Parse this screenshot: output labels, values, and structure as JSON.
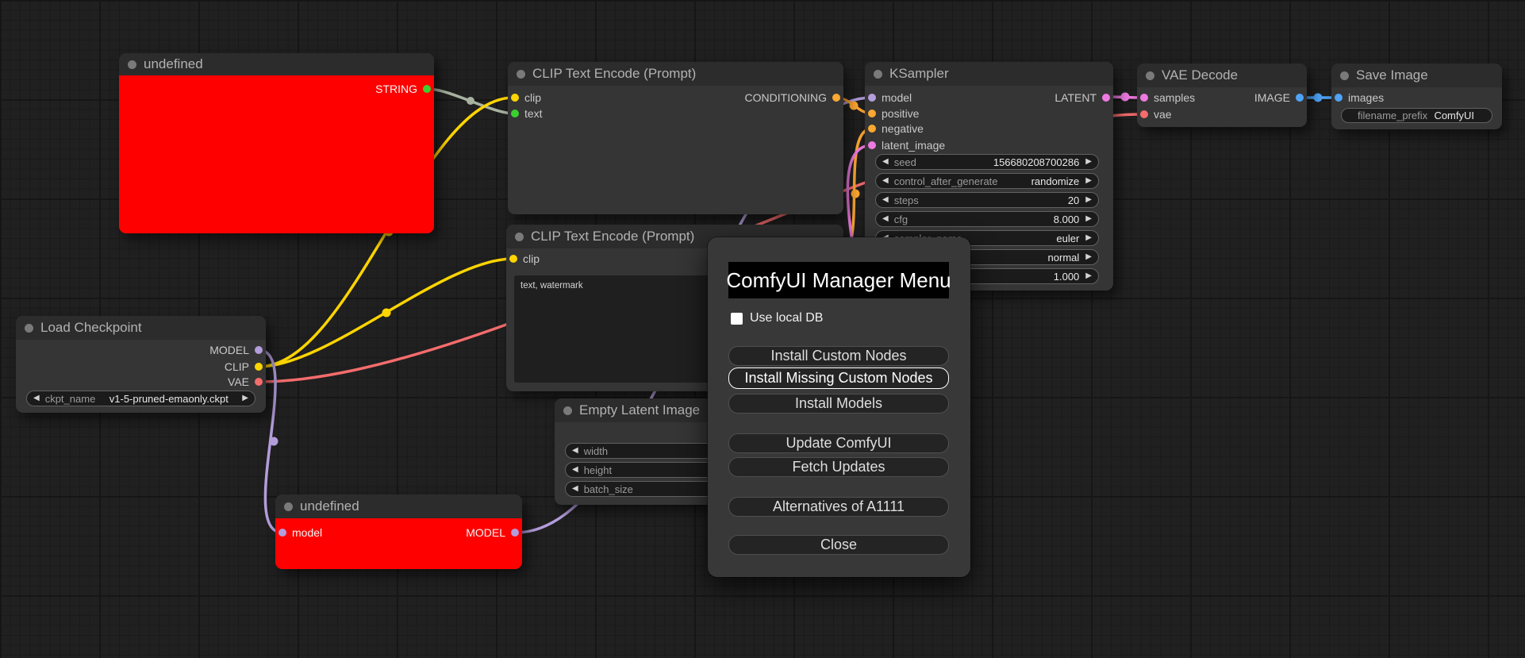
{
  "colors": {
    "MODEL": "#b39ddb",
    "CLIP": "#ffd500",
    "VAE": "#f56c6c",
    "CONDITIONING": "#ffa832",
    "LATENT": "#ee7ae0",
    "IMAGE": "#4fa4f7",
    "STRING_DOT": "#3ad130",
    "STRING_WIRE": "#a8b2a0",
    "ERROR_BODY": "#ff0000"
  },
  "nodes": {
    "undef_top": {
      "title": "undefined",
      "out_string": "STRING"
    },
    "clip1": {
      "title": "CLIP Text Encode (Prompt)",
      "in_clip": "clip",
      "in_text": "text",
      "out_cond": "CONDITIONING"
    },
    "clip2": {
      "title": "CLIP Text Encode (Prompt)",
      "in_clip": "clip",
      "prompt_text": "text, watermark"
    },
    "ksampler": {
      "title": "KSampler",
      "in_model": "model",
      "in_positive": "positive",
      "in_negative": "negative",
      "in_latent": "latent_image",
      "out_latent": "LATENT",
      "widgets": [
        {
          "label": "seed",
          "value": "156680208700286"
        },
        {
          "label": "control_after_generate",
          "value": "randomize"
        },
        {
          "label": "steps",
          "value": "20"
        },
        {
          "label": "cfg",
          "value": "8.000"
        },
        {
          "label": "sampler_name",
          "value": "euler"
        },
        {
          "label": "",
          "value": "normal"
        },
        {
          "label": "",
          "value": "1.000"
        }
      ]
    },
    "vae_decode": {
      "title": "VAE Decode",
      "in_samples": "samples",
      "in_vae": "vae",
      "out_image": "IMAGE"
    },
    "save_image": {
      "title": "Save Image",
      "in_images": "images",
      "widget": {
        "label": "filename_prefix",
        "value": "ComfyUI"
      }
    },
    "load_checkpoint": {
      "title": "Load Checkpoint",
      "out_model": "MODEL",
      "out_clip": "CLIP",
      "out_vae": "VAE",
      "widget": {
        "label": "ckpt_name",
        "value": "v1-5-pruned-emaonly.ckpt"
      }
    },
    "empty_latent": {
      "title": "Empty Latent Image",
      "widgets": [
        {
          "label": "width"
        },
        {
          "label": "height"
        },
        {
          "label": "batch_size"
        }
      ]
    },
    "undef_bottom": {
      "title": "undefined",
      "in_model": "model",
      "out_model": "MODEL"
    }
  },
  "dialog": {
    "title": "ComfyUI Manager Menu",
    "checkbox_label": "Use local DB",
    "buttons": [
      "Install Custom Nodes",
      "Install Missing Custom Nodes",
      "Install Models",
      "Update ComfyUI",
      "Fetch Updates",
      "Alternatives of A1111",
      "Close"
    ]
  }
}
